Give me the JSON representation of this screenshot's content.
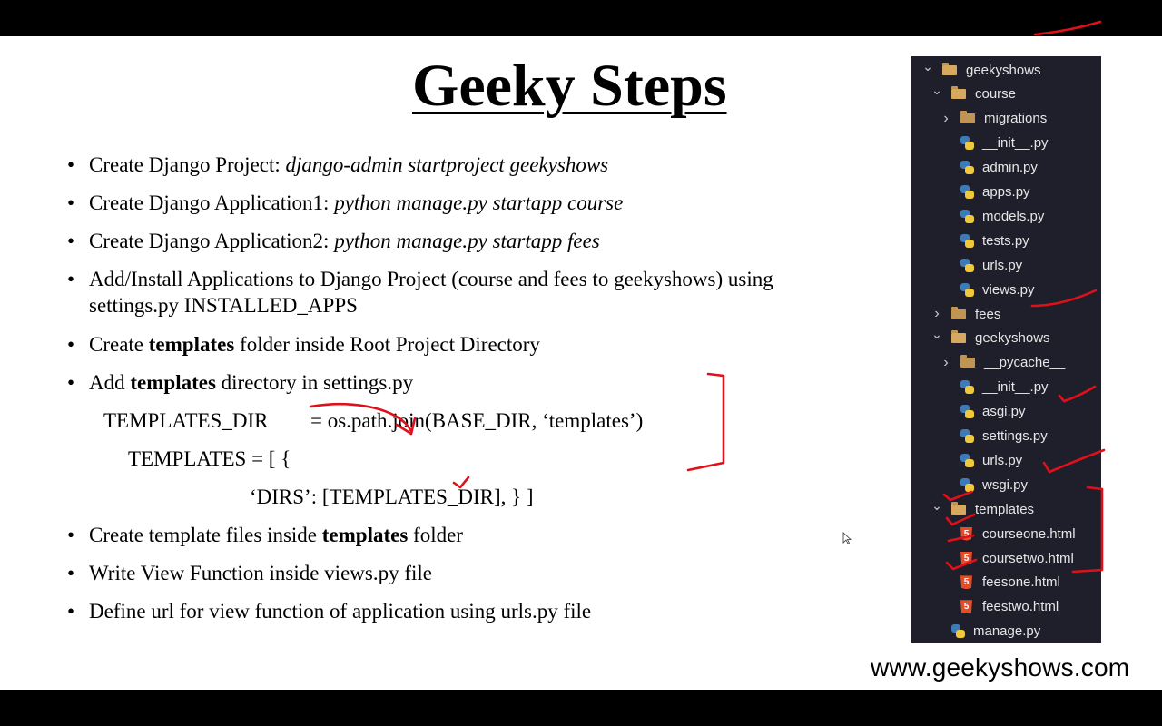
{
  "slide": {
    "title": "Geeky Steps",
    "steps": [
      {
        "prefix": "Create Django Project: ",
        "italic": "django-admin startproject geekyshows"
      },
      {
        "prefix": "Create Django Application1: ",
        "italic": "python manage.py startapp course"
      },
      {
        "prefix": "Create Django Application2: ",
        "italic": "python manage.py startapp fees"
      },
      {
        "line1": "Add/Install Applications to Django Project (course and fees to geekyshows) using",
        "line2": "settings.py INSTALLED_APPS"
      },
      {
        "prefix": "Create ",
        "bold": "templates",
        "suffix": " folder inside Root Project Directory"
      },
      {
        "prefix": "Add ",
        "bold": "templates",
        "suffix": " directory in settings.py"
      },
      {
        "prefix": "Create template files inside ",
        "bold": "templates",
        "suffix": " folder"
      },
      {
        "text": "Write View Function inside views.py file"
      },
      {
        "text": "Define url for view function of application using urls.py file"
      }
    ],
    "bullet_char": "•",
    "code": {
      "line1_name": "TEMPLATES_DIR",
      "line1_value": "= os.path.join(BASE_DIR, ‘templates’)",
      "line2": "TEMPLATES = [ {",
      "line3": "‘DIRS’: [TEMPLATES_DIR], } ]"
    },
    "watermark": "www.geekyshows.com"
  },
  "explorer": {
    "items": [
      {
        "label": "geekyshows",
        "type": "folder",
        "expanded": true
      },
      {
        "label": "course",
        "type": "folder",
        "expanded": true
      },
      {
        "label": "migrations",
        "type": "folder",
        "expanded": false
      },
      {
        "label": "__init__.py",
        "type": "py"
      },
      {
        "label": "admin.py",
        "type": "py"
      },
      {
        "label": "apps.py",
        "type": "py"
      },
      {
        "label": "models.py",
        "type": "py"
      },
      {
        "label": "tests.py",
        "type": "py"
      },
      {
        "label": "urls.py",
        "type": "py"
      },
      {
        "label": "views.py",
        "type": "py"
      },
      {
        "label": "fees",
        "type": "folder",
        "expanded": false
      },
      {
        "label": "geekyshows",
        "type": "folder",
        "expanded": true
      },
      {
        "label": "__pycache__",
        "type": "folder",
        "expanded": false
      },
      {
        "label": "__init__.py",
        "type": "py"
      },
      {
        "label": "asgi.py",
        "type": "py"
      },
      {
        "label": "settings.py",
        "type": "py"
      },
      {
        "label": "urls.py",
        "type": "py"
      },
      {
        "label": "wsgi.py",
        "type": "py"
      },
      {
        "label": "templates",
        "type": "folder",
        "expanded": true
      },
      {
        "label": "courseone.html",
        "type": "html"
      },
      {
        "label": "coursetwo.html",
        "type": "html"
      },
      {
        "label": "feesone.html",
        "type": "html"
      },
      {
        "label": "feestwo.html",
        "type": "html"
      },
      {
        "label": "manage.py",
        "type": "py"
      }
    ],
    "icons": {
      "folder": "folder-icon",
      "py": "python-file-icon",
      "html": "html-file-icon",
      "expanded": "chevron-down-icon",
      "collapsed": "chevron-right-icon"
    },
    "html_glyph": "5"
  },
  "colors": {
    "annotation": "#e0101a",
    "explorer_bg": "#1e1f2b",
    "folder": "#c09553"
  }
}
